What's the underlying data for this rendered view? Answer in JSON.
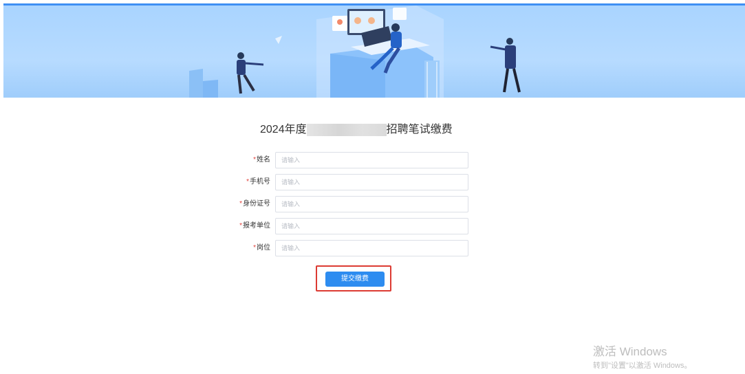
{
  "form": {
    "title_prefix": "2024年度",
    "title_suffix": "招聘笔试缴费",
    "fields": [
      {
        "label": "姓名",
        "required_mark": "*",
        "placeholder": "请输入"
      },
      {
        "label": "手机号",
        "required_mark": "*",
        "placeholder": "请输入"
      },
      {
        "label": "身份证号",
        "required_mark": "*",
        "placeholder": "请输入"
      },
      {
        "label": "报考单位",
        "required_mark": "*",
        "placeholder": "请输入"
      },
      {
        "label": "岗位",
        "required_mark": "*",
        "placeholder": "请输入"
      }
    ],
    "submit_label": "提交缴费"
  },
  "watermark": {
    "line1": "激活 Windows",
    "line2": "转到\"设置\"以激活 Windows。"
  },
  "colors": {
    "primary": "#2d8cf0",
    "highlight_border": "#dc3a32",
    "required": "#e0403a",
    "banner": "#b7dbff"
  }
}
